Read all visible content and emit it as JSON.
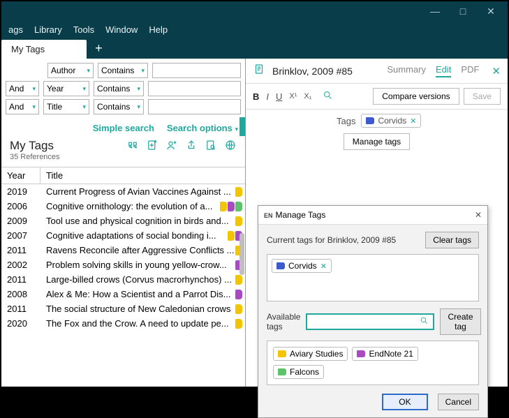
{
  "menubar": [
    "ags",
    "Library",
    "Tools",
    "Window",
    "Help"
  ],
  "tab": {
    "label": "My Tags"
  },
  "window_controls": {
    "min": "—",
    "max": "□",
    "close": "✕"
  },
  "search": {
    "rows": [
      {
        "op": "",
        "field": "Author",
        "cond": "Contains",
        "value": ""
      },
      {
        "op": "And",
        "field": "Year",
        "cond": "Contains",
        "value": ""
      },
      {
        "op": "And",
        "field": "Title",
        "cond": "Contains",
        "value": ""
      }
    ],
    "simple": "Simple search",
    "options": "Search options"
  },
  "group": {
    "title": "My Tags",
    "subtitle": "35 References"
  },
  "icons": [
    "quote",
    "add-ref",
    "add-person",
    "share",
    "search-doc",
    "web"
  ],
  "columns": {
    "year": "Year",
    "title": "Title"
  },
  "refs": [
    {
      "year": "2019",
      "title": "Current Progress of Avian Vaccines Against ...",
      "tags": [
        "#f3c400"
      ]
    },
    {
      "year": "2006",
      "title": "Cognitive ornithology: the evolution of a...",
      "tags": [
        "#f3c400",
        "#a84ac2",
        "#5ec26a"
      ]
    },
    {
      "year": "2009",
      "title": "Tool use and physical cognition in birds and...",
      "tags": [
        "#f3c400"
      ]
    },
    {
      "year": "2007",
      "title": "Cognitive adaptations of social bonding i...",
      "tags": [
        "#f3c400",
        "#a84ac2"
      ]
    },
    {
      "year": "2011",
      "title": "Ravens Reconcile after Aggressive Conflicts ...",
      "tags": [
        "#f3c400"
      ]
    },
    {
      "year": "2002",
      "title": "Problem solving skills in young yellow-crow...",
      "tags": [
        "#a84ac2"
      ]
    },
    {
      "year": "2011",
      "title": "Large-billed crows (Corvus macrorhynchos) ...",
      "tags": [
        "#f3c400"
      ]
    },
    {
      "year": "2008",
      "title": "Alex & Me: How a Scientist and a Parrot Dis...",
      "tags": [
        "#a84ac2"
      ]
    },
    {
      "year": "2011",
      "title": "The social structure of New Caledonian crows",
      "tags": [
        "#f3c400"
      ]
    },
    {
      "year": "2020",
      "title": "The Fox and the Crow. A need to update pe...",
      "tags": [
        "#f3c400"
      ]
    }
  ],
  "ref_header": {
    "title": "Brinklov, 2009 #85",
    "tabs": {
      "summary": "Summary",
      "edit": "Edit",
      "pdf": "PDF"
    }
  },
  "toolbar": {
    "bold": "B",
    "italic": "I",
    "underline": "U",
    "sup": "X¹",
    "sub": "X₁",
    "compare": "Compare versions",
    "save": "Save"
  },
  "tags_line": {
    "label": "Tags"
  },
  "current_tag": {
    "name": "Corvids",
    "color": "#3d5bcf"
  },
  "manage_btn": "Manage tags",
  "dialog": {
    "title": "Manage Tags",
    "prefix": "EN",
    "current_label": "Current tags for Brinklov, 2009 #85",
    "clear": "Clear tags",
    "avail_label": "Available tags",
    "create": "Create tag",
    "search_placeholder": "",
    "available": [
      {
        "name": "Aviary Studies",
        "color": "#f3c400"
      },
      {
        "name": "EndNote 21",
        "color": "#a84ac2"
      },
      {
        "name": "Falcons",
        "color": "#5ec26a"
      }
    ],
    "ok": "OK",
    "cancel": "Cancel"
  }
}
